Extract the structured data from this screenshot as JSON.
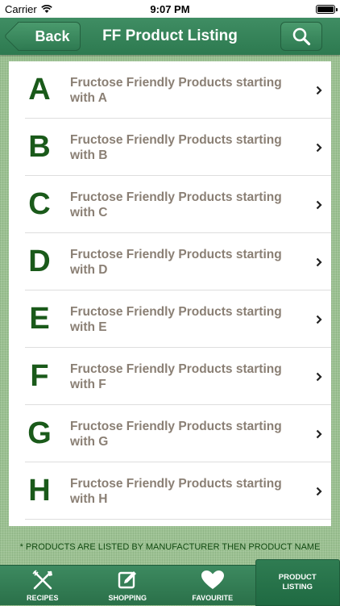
{
  "status_bar": {
    "carrier": "Carrier",
    "time": "9:07 PM"
  },
  "nav": {
    "back_label": "Back",
    "title": "FF Product Listing"
  },
  "list": {
    "items": [
      {
        "letter": "A",
        "text": "Fructose Friendly Products starting with A"
      },
      {
        "letter": "B",
        "text": "Fructose Friendly Products starting with B"
      },
      {
        "letter": "C",
        "text": "Fructose Friendly Products starting with C"
      },
      {
        "letter": "D",
        "text": "Fructose Friendly Products starting with D"
      },
      {
        "letter": "E",
        "text": "Fructose Friendly Products starting with E"
      },
      {
        "letter": "F",
        "text": "Fructose Friendly Products starting with F"
      },
      {
        "letter": "G",
        "text": "Fructose Friendly Products starting with G"
      },
      {
        "letter": "H",
        "text": "Fructose Friendly Products starting with H"
      }
    ]
  },
  "footnote": "* PRODUCTS ARE LISTED BY MANUFACTURER THEN PRODUCT NAME",
  "tabs": [
    {
      "label": "RECIPES",
      "icon": "fork-knife-icon"
    },
    {
      "label": "SHOPPING",
      "icon": "pencil-note-icon"
    },
    {
      "label": "FAVOURITE",
      "icon": "heart-icon"
    },
    {
      "label": "PRODUCT\nLISTING",
      "icon": "",
      "active": true
    }
  ],
  "colors": {
    "brand_green": "#2d7a50",
    "letter_green": "#1a5a1a",
    "item_text": "#8a7f74"
  }
}
